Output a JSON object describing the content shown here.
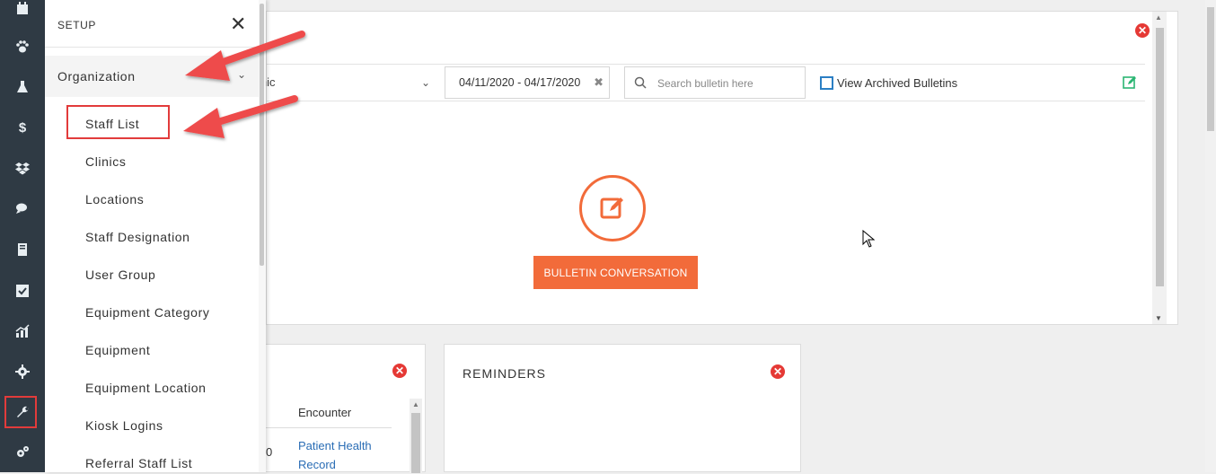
{
  "setup_menu": {
    "title": "SETUP",
    "close_glyph": "✕",
    "section": {
      "label": "Organization",
      "chevron": "⌄"
    },
    "items": [
      {
        "label": "Staff List"
      },
      {
        "label": "Clinics"
      },
      {
        "label": "Locations"
      },
      {
        "label": "Staff Designation"
      },
      {
        "label": "User Group"
      },
      {
        "label": "Equipment Category"
      },
      {
        "label": "Equipment"
      },
      {
        "label": "Equipment Location"
      },
      {
        "label": "Kiosk Logins"
      },
      {
        "label": "Referral Staff List"
      }
    ]
  },
  "rail": {
    "icons": [
      "calendar-icon",
      "paw-icon",
      "flask-icon",
      "dollar-icon",
      "dropbox-icon",
      "chat-icon",
      "book-icon",
      "checkbox-icon",
      "chart-icon",
      "gear-icon",
      "wrench-icon",
      "gears-icon"
    ],
    "dollar_glyph": "$",
    "active_icon": "wrench-icon"
  },
  "bulletin": {
    "clinic_select_value": "inic",
    "date_range": "04/11/2020 - 04/17/2020",
    "date_clear": "✖",
    "search_placeholder": "Search bulletin here",
    "archived_label": "View Archived Bulletins",
    "button_label": "BULLETIN CONVERSATION",
    "close_glyph": "✕"
  },
  "encounter_card": {
    "column_header": "Encounter",
    "row_value_fragment": "0",
    "row_link_line1": "Patient Health",
    "row_link_line2": "Record"
  },
  "reminders": {
    "title": "REMINDERS"
  },
  "colors": {
    "accent_orange": "#f26b3a",
    "close_red": "#e53935",
    "annotation_red": "#e23b3b",
    "rail_bg": "#2f3a44",
    "edit_green": "#2bb673"
  }
}
